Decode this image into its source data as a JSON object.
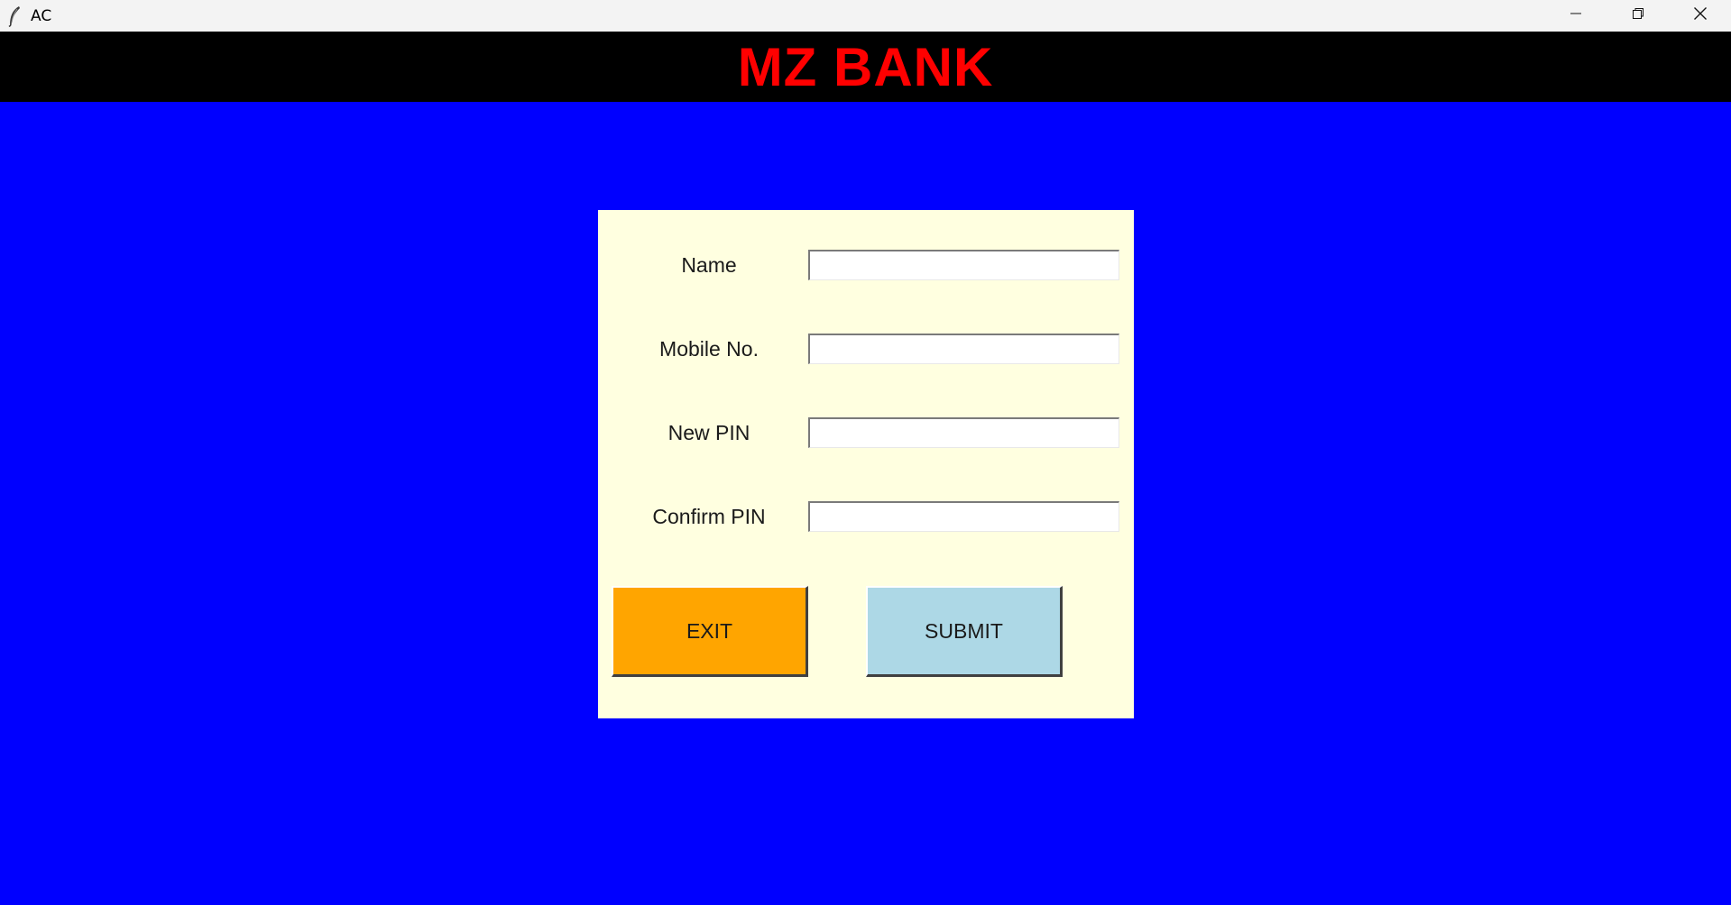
{
  "window": {
    "title": "AC",
    "icon": "feather-icon",
    "controls": [
      "minimize-icon",
      "restore-icon",
      "close-icon"
    ]
  },
  "header": {
    "title": "MZ BANK",
    "title_color": "#ff0000",
    "background": "#000000"
  },
  "page": {
    "background": "#0000ff"
  },
  "form": {
    "background": "#ffffe0",
    "fields": [
      {
        "label": "Name",
        "value": ""
      },
      {
        "label": "Mobile No.",
        "value": ""
      },
      {
        "label": "New PIN",
        "value": ""
      },
      {
        "label": "Confirm PIN",
        "value": ""
      }
    ],
    "buttons": {
      "exit": {
        "label": "EXIT",
        "color": "#ffa500"
      },
      "submit": {
        "label": "SUBMIT",
        "color": "#add8e6"
      }
    }
  }
}
